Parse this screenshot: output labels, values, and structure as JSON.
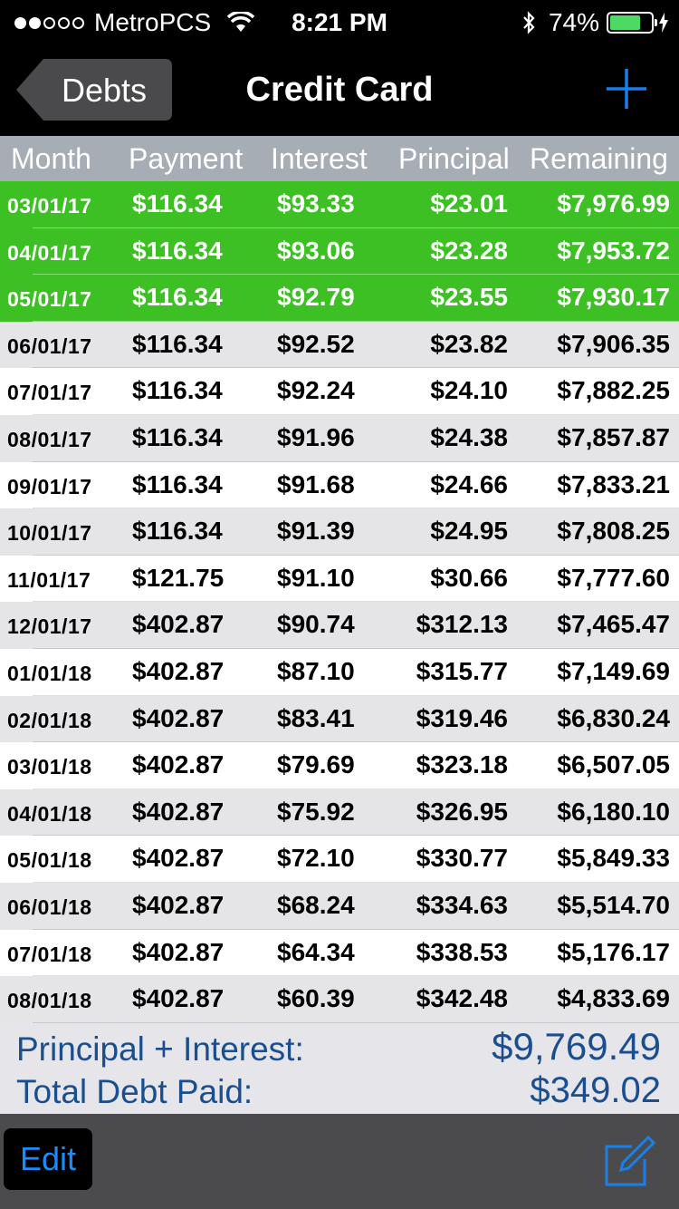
{
  "status_bar": {
    "carrier": "MetroPCS",
    "signal_strength": "2 of 5",
    "time": "8:21 PM",
    "battery_percent": "74%",
    "battery_level": 0.74
  },
  "nav": {
    "back_label": "Debts",
    "title": "Credit Card"
  },
  "table": {
    "headers": [
      "Month",
      "Payment",
      "Interest",
      "Principal",
      "Remaining"
    ],
    "rows": [
      {
        "month": "03/01/17",
        "payment": "$116.34",
        "interest": "$93.33",
        "principal": "$23.01",
        "remaining": "$7,976.99",
        "highlight": true
      },
      {
        "month": "04/01/17",
        "payment": "$116.34",
        "interest": "$93.06",
        "principal": "$23.28",
        "remaining": "$7,953.72",
        "highlight": true
      },
      {
        "month": "05/01/17",
        "payment": "$116.34",
        "interest": "$92.79",
        "principal": "$23.55",
        "remaining": "$7,930.17",
        "highlight": true
      },
      {
        "month": "06/01/17",
        "payment": "$116.34",
        "interest": "$92.52",
        "principal": "$23.82",
        "remaining": "$7,906.35",
        "highlight": false
      },
      {
        "month": "07/01/17",
        "payment": "$116.34",
        "interest": "$92.24",
        "principal": "$24.10",
        "remaining": "$7,882.25",
        "highlight": false
      },
      {
        "month": "08/01/17",
        "payment": "$116.34",
        "interest": "$91.96",
        "principal": "$24.38",
        "remaining": "$7,857.87",
        "highlight": false
      },
      {
        "month": "09/01/17",
        "payment": "$116.34",
        "interest": "$91.68",
        "principal": "$24.66",
        "remaining": "$7,833.21",
        "highlight": false
      },
      {
        "month": "10/01/17",
        "payment": "$116.34",
        "interest": "$91.39",
        "principal": "$24.95",
        "remaining": "$7,808.25",
        "highlight": false
      },
      {
        "month": "11/01/17",
        "payment": "$121.75",
        "interest": "$91.10",
        "principal": "$30.66",
        "remaining": "$7,777.60",
        "highlight": false
      },
      {
        "month": "12/01/17",
        "payment": "$402.87",
        "interest": "$90.74",
        "principal": "$312.13",
        "remaining": "$7,465.47",
        "highlight": false
      },
      {
        "month": "01/01/18",
        "payment": "$402.87",
        "interest": "$87.10",
        "principal": "$315.77",
        "remaining": "$7,149.69",
        "highlight": false
      },
      {
        "month": "02/01/18",
        "payment": "$402.87",
        "interest": "$83.41",
        "principal": "$319.46",
        "remaining": "$6,830.24",
        "highlight": false
      },
      {
        "month": "03/01/18",
        "payment": "$402.87",
        "interest": "$79.69",
        "principal": "$323.18",
        "remaining": "$6,507.05",
        "highlight": false
      },
      {
        "month": "04/01/18",
        "payment": "$402.87",
        "interest": "$75.92",
        "principal": "$326.95",
        "remaining": "$6,180.10",
        "highlight": false
      },
      {
        "month": "05/01/18",
        "payment": "$402.87",
        "interest": "$72.10",
        "principal": "$330.77",
        "remaining": "$5,849.33",
        "highlight": false
      },
      {
        "month": "06/01/18",
        "payment": "$402.87",
        "interest": "$68.24",
        "principal": "$334.63",
        "remaining": "$5,514.70",
        "highlight": false
      },
      {
        "month": "07/01/18",
        "payment": "$402.87",
        "interest": "$64.34",
        "principal": "$338.53",
        "remaining": "$5,176.17",
        "highlight": false
      },
      {
        "month": "08/01/18",
        "payment": "$402.87",
        "interest": "$60.39",
        "principal": "$342.48",
        "remaining": "$4,833.69",
        "highlight": false
      }
    ]
  },
  "summary": {
    "principal_interest_label": "Principal + Interest:",
    "principal_interest_value": "$9,769.49",
    "total_paid_label": "Total Debt Paid:",
    "total_paid_value": "$349.02"
  },
  "toolbar": {
    "edit_label": "Edit"
  },
  "colors": {
    "highlight_green": "#3cc024",
    "header_gray": "#a6adb5",
    "alt_row_gray": "#e5e5e7",
    "summary_blue": "#1a4e8e",
    "accent_blue": "#1a8cff"
  },
  "icons": {
    "add": "plus-icon",
    "compose": "compose-icon",
    "wifi": "wifi-icon",
    "bluetooth": "bluetooth-icon"
  }
}
